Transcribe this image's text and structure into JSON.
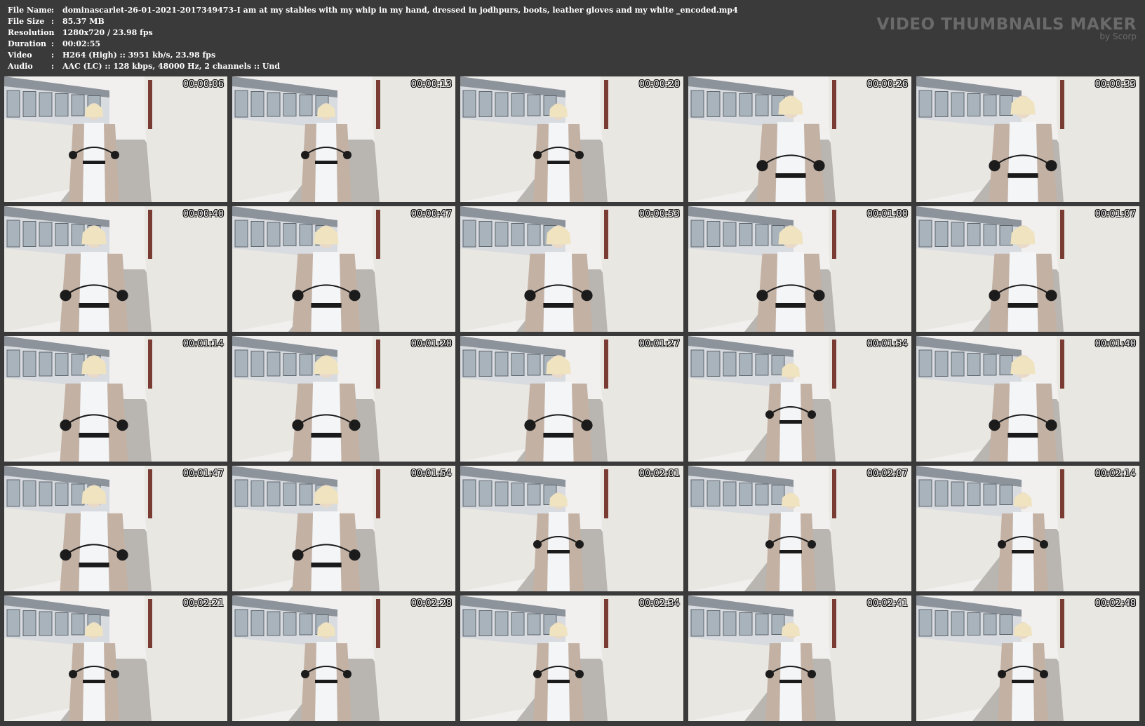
{
  "meta": [
    {
      "key": "File Name",
      "value": "dominascarlet-26-01-2021-2017349473-I am at my stables with my whip in my hand, dressed in jodhpurs, boots, leather gloves and my white _encoded.mp4"
    },
    {
      "key": "File Size",
      "value": "85.37 MB"
    },
    {
      "key": "Resolution",
      "value": "1280x720 / 23.98 fps"
    },
    {
      "key": "Duration",
      "value": "00:02:55"
    },
    {
      "key": "Video",
      "value": "H264 (High) :: 3951 kb/s, 23.98 fps"
    },
    {
      "key": "Audio",
      "value": "AAC (LC) :: 128 kbps, 48000 Hz, 2 channels :: Und"
    }
  ],
  "brand": {
    "title": "VIDEO THUMBNAILS MAKER",
    "subtitle": "by Scorp"
  },
  "colors": {
    "background": "#3a3a3a",
    "wall": "#e9e7e2",
    "coat": "#c3b1a4",
    "shirt": "#f4f5f7",
    "glove": "#1c1c1c",
    "jodhpurs": "#ece7dc"
  },
  "thumbnails": [
    {
      "time": "00:00:06"
    },
    {
      "time": "00:00:13"
    },
    {
      "time": "00:00:20"
    },
    {
      "time": "00:00:26"
    },
    {
      "time": "00:00:33"
    },
    {
      "time": "00:00:40"
    },
    {
      "time": "00:00:47"
    },
    {
      "time": "00:00:53"
    },
    {
      "time": "00:01:00"
    },
    {
      "time": "00:01:07"
    },
    {
      "time": "00:01:14"
    },
    {
      "time": "00:01:20"
    },
    {
      "time": "00:01:27"
    },
    {
      "time": "00:01:34"
    },
    {
      "time": "00:01:40"
    },
    {
      "time": "00:01:47"
    },
    {
      "time": "00:01:54"
    },
    {
      "time": "00:02:01"
    },
    {
      "time": "00:02:07"
    },
    {
      "time": "00:02:14"
    },
    {
      "time": "00:02:21"
    },
    {
      "time": "00:02:28"
    },
    {
      "time": "00:02:34"
    },
    {
      "time": "00:02:41"
    },
    {
      "time": "00:02:48"
    }
  ]
}
